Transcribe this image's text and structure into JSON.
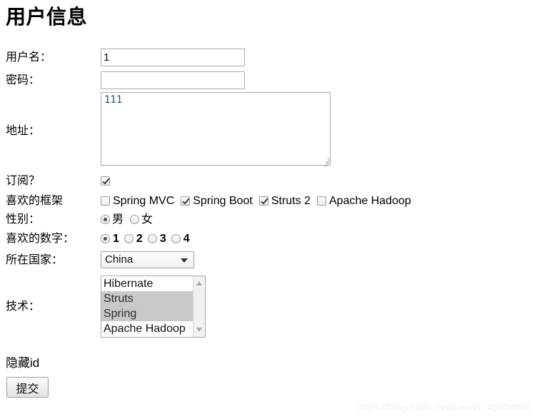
{
  "page": {
    "title": "用户信息",
    "hidden_id_label": "隐藏id",
    "watermark": "https://blog.csdn.net/weixin_45808666"
  },
  "form": {
    "username": {
      "label": "用户名：",
      "value": "1",
      "placeholder": ""
    },
    "password": {
      "label": "密码：",
      "value": "",
      "placeholder": ""
    },
    "address": {
      "label": "地址：",
      "value": "111",
      "placeholder": ""
    },
    "subscribe": {
      "label": "订阅？",
      "checked": true
    },
    "frameworks": {
      "label": "喜欢的框架",
      "options": [
        {
          "label": "Spring MVC",
          "checked": false
        },
        {
          "label": "Spring Boot",
          "checked": true
        },
        {
          "label": "Struts 2",
          "checked": true
        },
        {
          "label": "Apache Hadoop",
          "checked": false
        }
      ]
    },
    "gender": {
      "label": "性别：",
      "options": [
        {
          "label": "男",
          "selected": true
        },
        {
          "label": "女",
          "selected": false
        }
      ]
    },
    "favorite_number": {
      "label": "喜欢的数字：",
      "options": [
        {
          "label": "1",
          "selected": true
        },
        {
          "label": "2",
          "selected": false
        },
        {
          "label": "3",
          "selected": false
        },
        {
          "label": "4",
          "selected": false
        }
      ]
    },
    "country": {
      "label": "所在国家：",
      "value": "China"
    },
    "technology": {
      "label": "技术：",
      "options": [
        {
          "label": "Hibernate",
          "selected": false
        },
        {
          "label": "Struts",
          "selected": true
        },
        {
          "label": "Spring",
          "selected": true
        },
        {
          "label": "Apache Hadoop",
          "selected": false
        }
      ]
    },
    "submit": {
      "label": "提交"
    }
  }
}
